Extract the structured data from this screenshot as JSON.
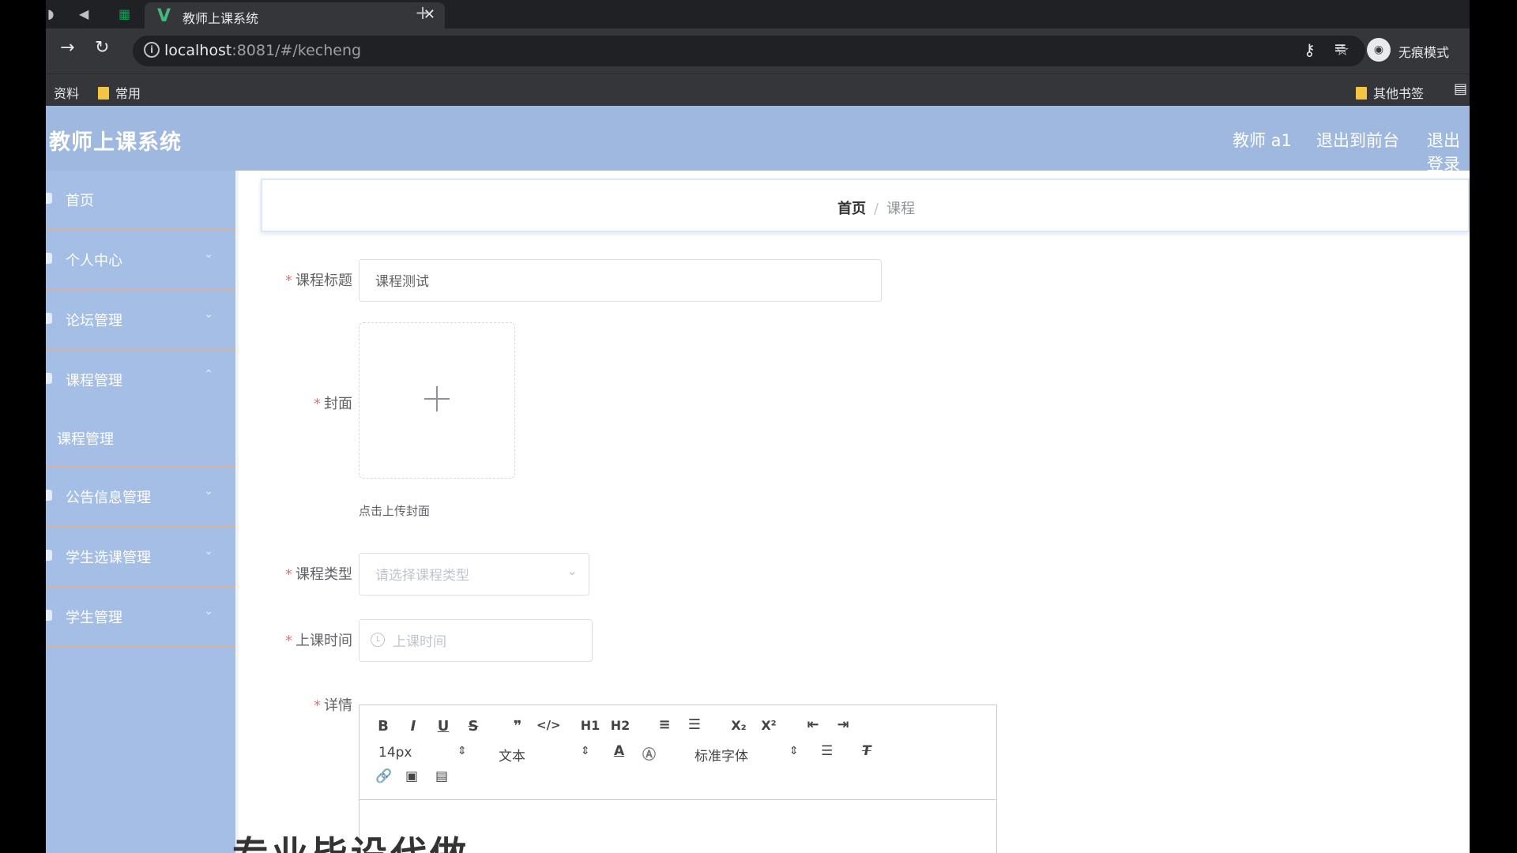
{
  "browser": {
    "tab_title": "教师上课系统",
    "tab_logo": "V",
    "close_glyph": "✕",
    "new_tab_glyph": "+",
    "url_host": "localhost",
    "url_rest": ":8081/#/kecheng",
    "incognito_label": "无痕模式",
    "bookmarks": [
      "资料",
      "常用"
    ],
    "other_bookmarks": "其他书签",
    "icons": [
      "back-arrow-icon",
      "forward-arrow-icon",
      "reload-icon",
      "info-icon",
      "key-icon",
      "star-icon",
      "tab-search-icon",
      "incognito-icon",
      "reading-list-icon"
    ]
  },
  "app": {
    "title": "教师上课系统",
    "header_links": [
      "教师 a1",
      "退出到前台",
      "退出登录"
    ]
  },
  "sidebar": {
    "items": [
      {
        "label": "首页"
      },
      {
        "label": "个人中心"
      },
      {
        "label": "论坛管理"
      },
      {
        "label": "课程管理"
      },
      {
        "label": "课程管理",
        "sub": true
      },
      {
        "label": "公告信息管理"
      },
      {
        "label": "学生选课管理"
      },
      {
        "label": "学生管理"
      }
    ]
  },
  "breadcrumb": {
    "home": "首页",
    "sep": "/",
    "current": "课程"
  },
  "form": {
    "title_label": "课程标题",
    "title_value": "课程测试",
    "cover_label": "封面",
    "cover_tip": "点击上传封面",
    "type_label": "课程类型",
    "type_placeholder": "请选择课程类型",
    "time_label": "上课时间",
    "time_placeholder": "上课时间",
    "detail_label": "详情",
    "required_mark": "*"
  },
  "editor": {
    "font_size": "14px",
    "header_select": "文本",
    "font_family": "标准字体",
    "buttons": [
      "B",
      "I",
      "U",
      "S",
      "❞",
      "</>",
      "H1",
      "H2",
      "≡",
      "☰",
      "X₂",
      "X²",
      "⇤",
      "⇥"
    ]
  },
  "overlay": {
    "text": "专业毕设代做"
  }
}
